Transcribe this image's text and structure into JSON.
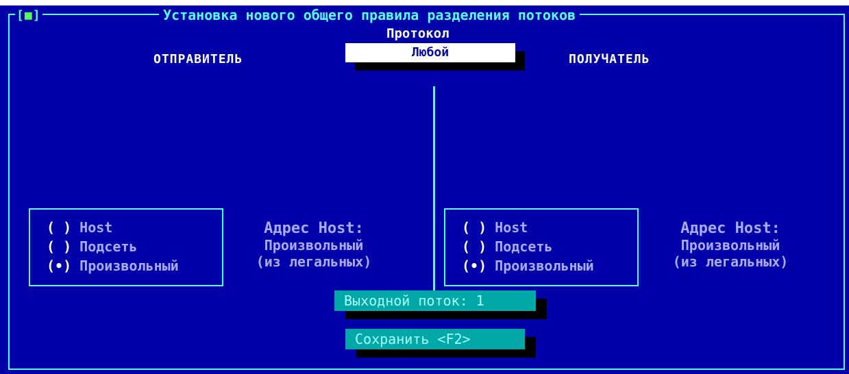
{
  "window": {
    "close_mark": "■",
    "title": "Установка нового общего правила разделения потоков"
  },
  "protocol": {
    "label": "Протокол",
    "value": "Любой"
  },
  "sender": {
    "heading": "ОТПРАВИТЕЛЬ",
    "options": [
      {
        "mark": "( )",
        "label": "Host",
        "selected": false
      },
      {
        "mark": "( )",
        "label": "Подсеть",
        "selected": false
      },
      {
        "mark": "(•)",
        "label": "Произвольный",
        "selected": true
      }
    ],
    "address": {
      "title": "Адрес Host:",
      "value": "Произвольный",
      "note": "(из легальных)"
    }
  },
  "receiver": {
    "heading": "ПОЛУЧАТЕЛЬ",
    "options": [
      {
        "mark": "( )",
        "label": "Host",
        "selected": false
      },
      {
        "mark": "( )",
        "label": "Подсеть",
        "selected": false
      },
      {
        "mark": "(•)",
        "label": "Произвольный",
        "selected": true
      }
    ],
    "address": {
      "title": "Адрес Host:",
      "value": "Произвольный",
      "note": "(из легальных)"
    }
  },
  "output_stream": {
    "label": "Выходной поток: 1"
  },
  "save_button": {
    "label": "Сохранить  <F2>"
  },
  "colors": {
    "background": "#0000a8",
    "frame": "#55ffff",
    "button": "#00a8a8"
  }
}
